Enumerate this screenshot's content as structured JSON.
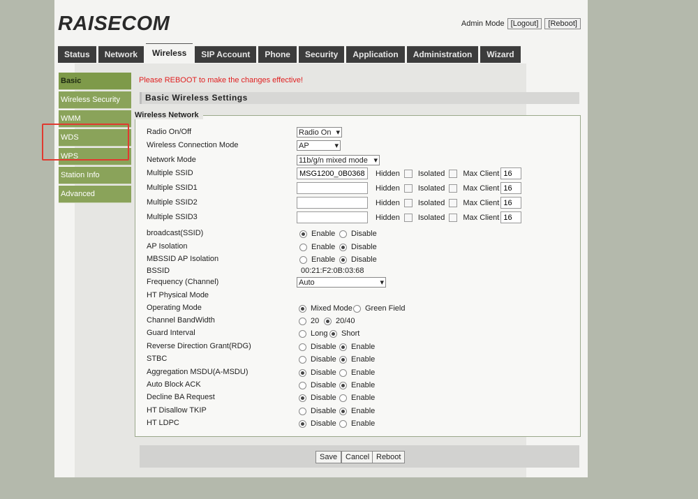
{
  "brand": "RAISECOM",
  "admin": {
    "mode_label": "Admin Mode",
    "logout": "[Logout]",
    "reboot": "[Reboot]"
  },
  "tabs": [
    "Status",
    "Network",
    "Wireless",
    "SIP Account",
    "Phone",
    "Security",
    "Application",
    "Administration",
    "Wizard"
  ],
  "active_tab": "Wireless",
  "sidebar": [
    "Basic",
    "Wireless Security",
    "WMM",
    "WDS",
    "WPS",
    "Station Info",
    "Advanced"
  ],
  "active_side": "Basic",
  "notice": "Please REBOOT to make the changes effective!",
  "section_title": "Basic Wireless Settings",
  "legend": "Wireless Network",
  "fields": {
    "radio_onoff": {
      "label": "Radio On/Off",
      "value": "Radio On"
    },
    "conn_mode": {
      "label": "Wireless Connection Mode",
      "value": "AP"
    },
    "net_mode": {
      "label": "Network Mode",
      "value": "11b/g/n mixed mode"
    },
    "ssids": [
      {
        "label": "Multiple SSID",
        "value": "MSG1200_0B0368",
        "max": "16"
      },
      {
        "label": "Multiple SSID1",
        "value": "",
        "max": "16"
      },
      {
        "label": "Multiple SSID2",
        "value": "",
        "max": "16"
      },
      {
        "label": "Multiple SSID3",
        "value": "",
        "max": "16"
      }
    ],
    "hidden_label": "Hidden",
    "isolated_label": "Isolated",
    "maxclient_label": "Max Client",
    "bssid": {
      "label": "BSSID",
      "value": "00:21:F2:0B:03:68"
    },
    "freq": {
      "label": "Frequency (Channel)",
      "value": "Auto"
    },
    "ht_phys": "HT Physical Mode"
  },
  "radios": [
    {
      "label": "broadcast(SSID)",
      "opts": [
        "Enable",
        "Disable"
      ],
      "sel": 0
    },
    {
      "label": "AP Isolation",
      "opts": [
        "Enable",
        "Disable"
      ],
      "sel": 1
    },
    {
      "label": "MBSSID AP Isolation",
      "opts": [
        "Enable",
        "Disable"
      ],
      "sel": 1
    },
    {
      "label": "Operating Mode",
      "opts": [
        "Mixed Mode",
        "Green Field"
      ],
      "sel": 0
    },
    {
      "label": "Channel BandWidth",
      "opts": [
        "20",
        "20/40"
      ],
      "sel": 1
    },
    {
      "label": "Guard Interval",
      "opts": [
        "Long",
        "Short"
      ],
      "sel": 1
    },
    {
      "label": "Reverse Direction Grant(RDG)",
      "opts": [
        "Disable",
        "Enable"
      ],
      "sel": 1
    },
    {
      "label": "STBC",
      "opts": [
        "Disable",
        "Enable"
      ],
      "sel": 1
    },
    {
      "label": "Aggregation MSDU(A-MSDU)",
      "opts": [
        "Disable",
        "Enable"
      ],
      "sel": 0
    },
    {
      "label": "Auto Block ACK",
      "opts": [
        "Disable",
        "Enable"
      ],
      "sel": 1
    },
    {
      "label": "Decline BA Request",
      "opts": [
        "Disable",
        "Enable"
      ],
      "sel": 0
    },
    {
      "label": "HT Disallow TKIP",
      "opts": [
        "Disable",
        "Enable"
      ],
      "sel": 1
    },
    {
      "label": "HT LDPC",
      "opts": [
        "Disable",
        "Enable"
      ],
      "sel": 0
    }
  ],
  "buttons": {
    "save": "Save",
    "cancel": "Cancel",
    "reboot": "Reboot"
  },
  "colors": {
    "highlight": "#e03a30",
    "sidebar": "#8aa35a",
    "tabs": "#3c3c3c",
    "notice": "#e02020"
  }
}
